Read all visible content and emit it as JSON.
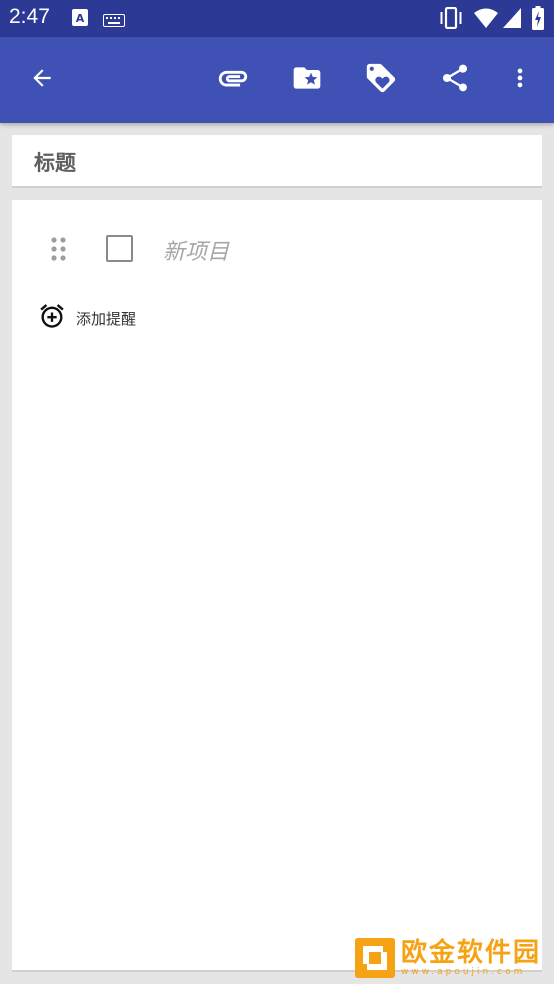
{
  "status_bar": {
    "time": "2:47",
    "icons": [
      "a-keyboard-icon",
      "keyboard-icon",
      "vibrate-icon",
      "wifi-icon",
      "signal-icon",
      "battery-charging-icon"
    ]
  },
  "app_bar": {
    "icons": [
      "back-arrow-icon",
      "attachment-icon",
      "folder-star-icon",
      "tag-heart-icon",
      "share-icon",
      "more-vert-icon"
    ]
  },
  "note": {
    "title_placeholder": "标题",
    "new_item_placeholder": "新项目",
    "add_reminder_label": "添加提醒"
  },
  "watermark": {
    "text": "欧金软件园",
    "url": "www.apoujin.com"
  },
  "colors": {
    "status_bar": "#2c3a96",
    "app_bar": "#3f51b5",
    "background": "#e5e5e5",
    "watermark": "#f5a314"
  }
}
